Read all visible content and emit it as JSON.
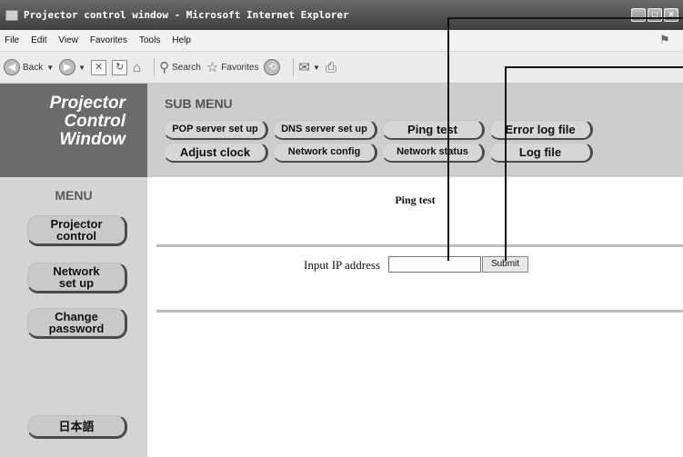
{
  "window": {
    "title": "Projector control window - Microsoft Internet Explorer",
    "buttons": [
      "_",
      "□",
      "×"
    ]
  },
  "menubar": {
    "items": [
      "File",
      "Edit",
      "View",
      "Favorites",
      "Tools",
      "Help"
    ]
  },
  "toolbar": {
    "back_label": "Back",
    "search_label": "Search",
    "favorites_label": "Favorites"
  },
  "logo": {
    "line1": "Projector",
    "line2": "Control",
    "line3": "Window"
  },
  "submenu": {
    "title": "SUB MENU",
    "buttons": [
      "POP server set up",
      "DNS server set up",
      "Ping test",
      "Error log file",
      "Adjust clock",
      "Network config",
      "Network status",
      "Log file"
    ]
  },
  "leftmenu": {
    "title": "MENU",
    "items": [
      {
        "line1": "Projector",
        "line2": "control"
      },
      {
        "line1": "Network",
        "line2": "set up"
      },
      {
        "line1": "Change",
        "line2": "password"
      }
    ],
    "language_label": "日本語"
  },
  "main": {
    "page_title": "Ping test",
    "ip_label": "Input IP address",
    "ip_value": "",
    "submit_label": "Submit"
  },
  "colors": {
    "logo_bg": "#6b6b6b",
    "submenu_bg": "#cdcdcd",
    "sidebar_bg": "#d4d4d4",
    "titlebar_bg": "#4a4a4a"
  },
  "icons": [
    "window-app-icon",
    "back-arrow-icon",
    "forward-arrow-icon",
    "stop-icon",
    "refresh-icon",
    "home-icon",
    "search-icon",
    "favorites-star-icon",
    "history-icon",
    "mail-icon",
    "print-icon",
    "windows-flag-icon"
  ]
}
